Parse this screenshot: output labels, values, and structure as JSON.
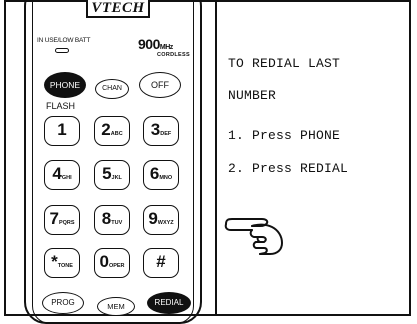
{
  "handset": {
    "brand": "VTECH",
    "indicator_label": "IN USE/LOW BATT",
    "freq_value": "900",
    "freq_unit": "MHz",
    "cordless": "CORDLESS",
    "flash_label": "FLASH",
    "buttons": {
      "phone": "PHONE",
      "chan": "CHAN",
      "off": "OFF",
      "prog": "PROG",
      "mem": "MEM",
      "redial": "REDIAL"
    },
    "keys": [
      {
        "digit": "1",
        "letters": ""
      },
      {
        "digit": "2",
        "letters": "ABC"
      },
      {
        "digit": "3",
        "letters": "DEF"
      },
      {
        "digit": "4",
        "letters": "GHI"
      },
      {
        "digit": "5",
        "letters": "JKL"
      },
      {
        "digit": "6",
        "letters": "MNO"
      },
      {
        "digit": "7",
        "letters": "PQRS"
      },
      {
        "digit": "8",
        "letters": "TUV"
      },
      {
        "digit": "9",
        "letters": "WXYZ"
      },
      {
        "digit": "*",
        "letters": "TONE"
      },
      {
        "digit": "0",
        "letters": "OPER"
      },
      {
        "digit": "#",
        "letters": ""
      }
    ]
  },
  "instructions": {
    "title_line1": "TO REDIAL LAST",
    "title_line2": "NUMBER",
    "step1": "1. Press PHONE",
    "step2": "2. Press REDIAL"
  },
  "icons": {
    "pointer": "pointing-hand-icon"
  }
}
